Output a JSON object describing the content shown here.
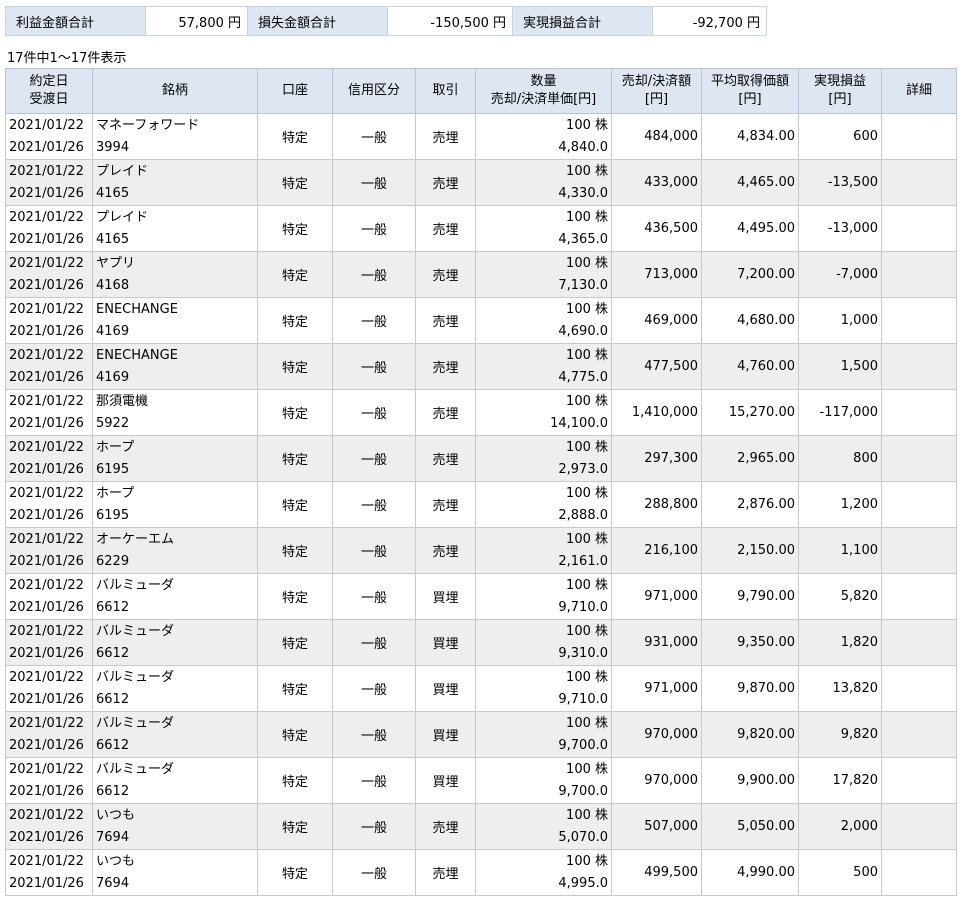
{
  "summary": {
    "profit_label": "利益金額合計",
    "profit_value": "57,800 円",
    "loss_label": "損失金額合計",
    "loss_value": "-150,500 円",
    "realized_label": "実現損益合計",
    "realized_value": "-92,700 円"
  },
  "count_text": "17件中1～17件表示",
  "headers": {
    "date_1": "約定日",
    "date_2": "受渡日",
    "name": "銘柄",
    "account": "口座",
    "credit": "信用区分",
    "trade": "取引",
    "qty_1": "数量",
    "qty_2": "売却/決済単価[円]",
    "amount_1": "売却/決済額",
    "amount_2": "[円]",
    "avg_1": "平均取得価額",
    "avg_2": "[円]",
    "pl_1": "実現損益",
    "pl_2": "[円]",
    "detail": "詳細"
  },
  "rows": [
    {
      "trade_date": "2021/01/22",
      "settle_date": "2021/01/26",
      "name": "マネーフォワード",
      "code": "3994",
      "account": "特定",
      "credit": "一般",
      "trade": "売埋",
      "qty": "100 株",
      "price": "4,840.0",
      "amount": "484,000",
      "avg": "4,834.00",
      "pl": "600"
    },
    {
      "trade_date": "2021/01/22",
      "settle_date": "2021/01/26",
      "name": "プレイド",
      "code": "4165",
      "account": "特定",
      "credit": "一般",
      "trade": "売埋",
      "qty": "100 株",
      "price": "4,330.0",
      "amount": "433,000",
      "avg": "4,465.00",
      "pl": "-13,500"
    },
    {
      "trade_date": "2021/01/22",
      "settle_date": "2021/01/26",
      "name": "プレイド",
      "code": "4165",
      "account": "特定",
      "credit": "一般",
      "trade": "売埋",
      "qty": "100 株",
      "price": "4,365.0",
      "amount": "436,500",
      "avg": "4,495.00",
      "pl": "-13,000"
    },
    {
      "trade_date": "2021/01/22",
      "settle_date": "2021/01/26",
      "name": "ヤプリ",
      "code": "4168",
      "account": "特定",
      "credit": "一般",
      "trade": "売埋",
      "qty": "100 株",
      "price": "7,130.0",
      "amount": "713,000",
      "avg": "7,200.00",
      "pl": "-7,000"
    },
    {
      "trade_date": "2021/01/22",
      "settle_date": "2021/01/26",
      "name": "ENECHANGE",
      "code": "4169",
      "account": "特定",
      "credit": "一般",
      "trade": "売埋",
      "qty": "100 株",
      "price": "4,690.0",
      "amount": "469,000",
      "avg": "4,680.00",
      "pl": "1,000"
    },
    {
      "trade_date": "2021/01/22",
      "settle_date": "2021/01/26",
      "name": "ENECHANGE",
      "code": "4169",
      "account": "特定",
      "credit": "一般",
      "trade": "売埋",
      "qty": "100 株",
      "price": "4,775.0",
      "amount": "477,500",
      "avg": "4,760.00",
      "pl": "1,500"
    },
    {
      "trade_date": "2021/01/22",
      "settle_date": "2021/01/26",
      "name": "那須電機",
      "code": "5922",
      "account": "特定",
      "credit": "一般",
      "trade": "売埋",
      "qty": "100 株",
      "price": "14,100.0",
      "amount": "1,410,000",
      "avg": "15,270.00",
      "pl": "-117,000"
    },
    {
      "trade_date": "2021/01/22",
      "settle_date": "2021/01/26",
      "name": "ホープ",
      "code": "6195",
      "account": "特定",
      "credit": "一般",
      "trade": "売埋",
      "qty": "100 株",
      "price": "2,973.0",
      "amount": "297,300",
      "avg": "2,965.00",
      "pl": "800"
    },
    {
      "trade_date": "2021/01/22",
      "settle_date": "2021/01/26",
      "name": "ホープ",
      "code": "6195",
      "account": "特定",
      "credit": "一般",
      "trade": "売埋",
      "qty": "100 株",
      "price": "2,888.0",
      "amount": "288,800",
      "avg": "2,876.00",
      "pl": "1,200"
    },
    {
      "trade_date": "2021/01/22",
      "settle_date": "2021/01/26",
      "name": "オーケーエム",
      "code": "6229",
      "account": "特定",
      "credit": "一般",
      "trade": "売埋",
      "qty": "100 株",
      "price": "2,161.0",
      "amount": "216,100",
      "avg": "2,150.00",
      "pl": "1,100"
    },
    {
      "trade_date": "2021/01/22",
      "settle_date": "2021/01/26",
      "name": "バルミューダ",
      "code": "6612",
      "account": "特定",
      "credit": "一般",
      "trade": "買埋",
      "qty": "100 株",
      "price": "9,710.0",
      "amount": "971,000",
      "avg": "9,790.00",
      "pl": "5,820"
    },
    {
      "trade_date": "2021/01/22",
      "settle_date": "2021/01/26",
      "name": "バルミューダ",
      "code": "6612",
      "account": "特定",
      "credit": "一般",
      "trade": "買埋",
      "qty": "100 株",
      "price": "9,310.0",
      "amount": "931,000",
      "avg": "9,350.00",
      "pl": "1,820"
    },
    {
      "trade_date": "2021/01/22",
      "settle_date": "2021/01/26",
      "name": "バルミューダ",
      "code": "6612",
      "account": "特定",
      "credit": "一般",
      "trade": "買埋",
      "qty": "100 株",
      "price": "9,710.0",
      "amount": "971,000",
      "avg": "9,870.00",
      "pl": "13,820"
    },
    {
      "trade_date": "2021/01/22",
      "settle_date": "2021/01/26",
      "name": "バルミューダ",
      "code": "6612",
      "account": "特定",
      "credit": "一般",
      "trade": "買埋",
      "qty": "100 株",
      "price": "9,700.0",
      "amount": "970,000",
      "avg": "9,820.00",
      "pl": "9,820"
    },
    {
      "trade_date": "2021/01/22",
      "settle_date": "2021/01/26",
      "name": "バルミューダ",
      "code": "6612",
      "account": "特定",
      "credit": "一般",
      "trade": "買埋",
      "qty": "100 株",
      "price": "9,700.0",
      "amount": "970,000",
      "avg": "9,900.00",
      "pl": "17,820"
    },
    {
      "trade_date": "2021/01/22",
      "settle_date": "2021/01/26",
      "name": "いつも",
      "code": "7694",
      "account": "特定",
      "credit": "一般",
      "trade": "売埋",
      "qty": "100 株",
      "price": "5,070.0",
      "amount": "507,000",
      "avg": "5,050.00",
      "pl": "2,000"
    },
    {
      "trade_date": "2021/01/22",
      "settle_date": "2021/01/26",
      "name": "いつも",
      "code": "7694",
      "account": "特定",
      "credit": "一般",
      "trade": "売埋",
      "qty": "100 株",
      "price": "4,995.0",
      "amount": "499,500",
      "avg": "4,990.00",
      "pl": "500"
    }
  ]
}
